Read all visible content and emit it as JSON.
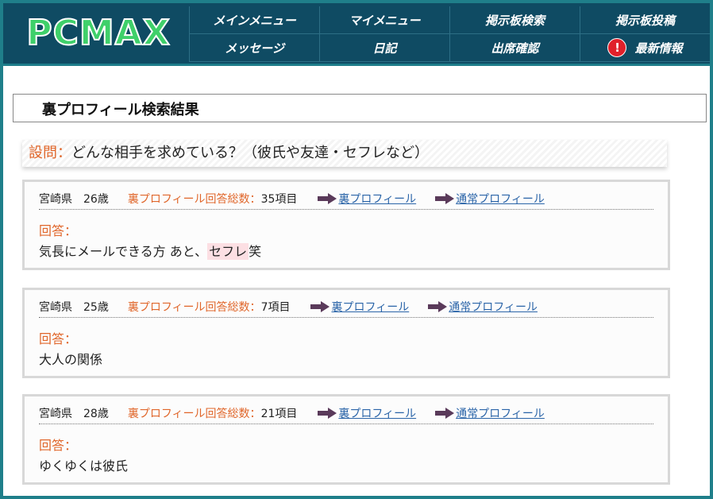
{
  "header": {
    "logo": "PCMAX",
    "nav": [
      {
        "label": "メインメニュー",
        "name": "nav-main-menu"
      },
      {
        "label": "マイメニュー",
        "name": "nav-my-menu"
      },
      {
        "label": "掲示板検索",
        "name": "nav-board-search"
      },
      {
        "label": "掲示板投稿",
        "name": "nav-board-post"
      },
      {
        "label": "メッセージ",
        "name": "nav-message"
      },
      {
        "label": "日記",
        "name": "nav-diary"
      },
      {
        "label": "出席確認",
        "name": "nav-attendance"
      },
      {
        "label": "最新情報",
        "name": "nav-latest-info",
        "alert": "!"
      }
    ]
  },
  "page": {
    "title": "裏プロフィール検索結果",
    "question_label": "設問：",
    "question_text": "どんな相手を求めている？（彼氏や友達・セフレなど）"
  },
  "results": [
    {
      "prefecture": "宮崎県",
      "age": "26歳",
      "count_label": "裏プロフィール回答総数：",
      "count": "35項目",
      "link_ura": "裏プロフィール",
      "link_normal": "通常プロフィール",
      "answer_label": "回答：",
      "answer_before": "気長にメールできる方 あと、",
      "answer_highlight": "セフレ",
      "answer_after": "笑"
    },
    {
      "prefecture": "宮崎県",
      "age": "25歳",
      "count_label": "裏プロフィール回答総数：",
      "count": "7項目",
      "link_ura": "裏プロフィール",
      "link_normal": "通常プロフィール",
      "answer_label": "回答：",
      "answer_before": "大人の関係",
      "answer_highlight": "",
      "answer_after": ""
    },
    {
      "prefecture": "宮崎県",
      "age": "28歳",
      "count_label": "裏プロフィール回答総数：",
      "count": "21項目",
      "link_ura": "裏プロフィール",
      "link_normal": "通常プロフィール",
      "answer_label": "回答：",
      "answer_before": "ゆくゆくは彼氏",
      "answer_highlight": "",
      "answer_after": ""
    }
  ],
  "colors": {
    "header_bg": "#0f4b63",
    "logo_green": "#3fd06a",
    "accent_orange": "#e0662a",
    "link_blue": "#2a64a8",
    "highlight_pink": "#fcdfe3",
    "arrow_purple": "#5a3a5a"
  }
}
